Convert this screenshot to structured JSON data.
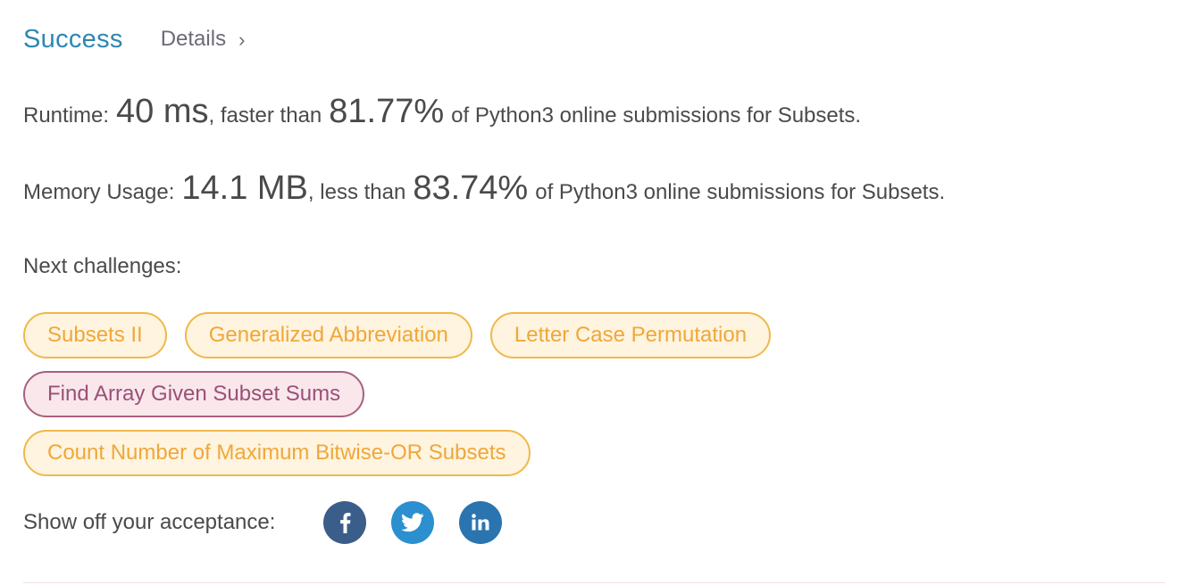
{
  "header": {
    "status": "Success",
    "details_label": "Details",
    "details_chevron": "›"
  },
  "runtime": {
    "label": "Runtime:",
    "value": "40 ms",
    "comparison": ", faster than",
    "percent": "81.77%",
    "suffix": "of Python3 online submissions for Subsets."
  },
  "memory": {
    "label": "Memory Usage:",
    "value": "14.1 MB",
    "comparison": ", less than",
    "percent": "83.74%",
    "suffix": "of Python3 online submissions for Subsets."
  },
  "next_challenges": {
    "label": "Next challenges:",
    "items": [
      {
        "title": "Subsets II",
        "difficulty": "medium"
      },
      {
        "title": "Generalized Abbreviation",
        "difficulty": "medium"
      },
      {
        "title": "Letter Case Permutation",
        "difficulty": "medium"
      },
      {
        "title": "Find Array Given Subset Sums",
        "difficulty": "hard"
      },
      {
        "title": "Count Number of Maximum Bitwise-OR Subsets",
        "difficulty": "medium"
      }
    ]
  },
  "share": {
    "label": "Show off your acceptance:",
    "icons": [
      "facebook-icon",
      "twitter-icon",
      "linkedin-icon"
    ]
  },
  "colors": {
    "success": "#2e86b3",
    "medium_chip_bg": "#fef4df",
    "medium_chip_border": "#f0b84a",
    "hard_chip_bg": "#f9e7ec",
    "hard_chip_border": "#a76080",
    "facebook": "#3b5d8a",
    "twitter": "#2b8fd0",
    "linkedin": "#2a74b0"
  }
}
